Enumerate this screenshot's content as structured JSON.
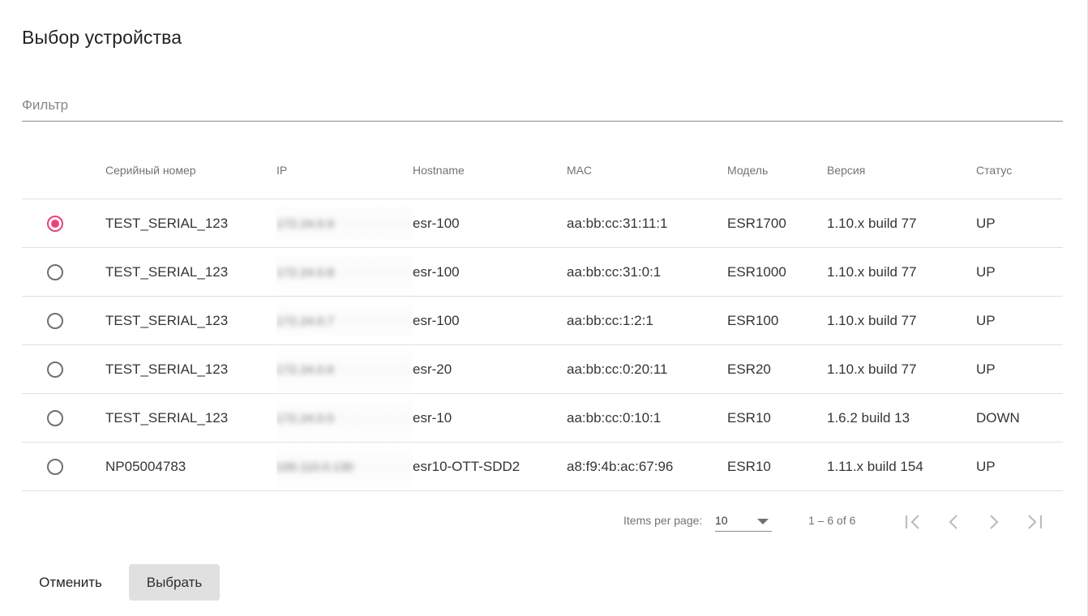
{
  "dialog": {
    "title": "Выбор устройства"
  },
  "filter": {
    "placeholder": "Фильтр",
    "value": ""
  },
  "table": {
    "columns": [
      "Серийный номер",
      "IP",
      "Hostname",
      "MAC",
      "Модель",
      "Версия",
      "Статус"
    ],
    "rows": [
      {
        "selected": true,
        "serial": "TEST_SERIAL_123",
        "ip": "172.24.0.9",
        "hostname": "esr-100",
        "mac": "aa:bb:cc:31:11:1",
        "model": "ESR1700",
        "version": "1.10.x build 77",
        "status": "UP"
      },
      {
        "selected": false,
        "serial": "TEST_SERIAL_123",
        "ip": "172.24.0.8",
        "hostname": "esr-100",
        "mac": "aa:bb:cc:31:0:1",
        "model": "ESR1000",
        "version": "1.10.x build 77",
        "status": "UP"
      },
      {
        "selected": false,
        "serial": "TEST_SERIAL_123",
        "ip": "172.24.0.7",
        "hostname": "esr-100",
        "mac": "aa:bb:cc:1:2:1",
        "model": "ESR100",
        "version": "1.10.x build 77",
        "status": "UP"
      },
      {
        "selected": false,
        "serial": "TEST_SERIAL_123",
        "ip": "172.24.0.6",
        "hostname": "esr-20",
        "mac": "aa:bb:cc:0:20:11",
        "model": "ESR20",
        "version": "1.10.x build 77",
        "status": "UP"
      },
      {
        "selected": false,
        "serial": "TEST_SERIAL_123",
        "ip": "172.24.0.5",
        "hostname": "esr-10",
        "mac": "aa:bb:cc:0:10:1",
        "model": "ESR10",
        "version": "1.6.2 build 13",
        "status": "DOWN"
      },
      {
        "selected": false,
        "serial": "NP05004783",
        "ip": "100.110.0.130",
        "hostname": "esr10-OTT-SDD2",
        "mac": "a8:f9:4b:ac:67:96",
        "model": "ESR10",
        "version": "1.11.x build 154",
        "status": "UP"
      }
    ]
  },
  "paginator": {
    "items_per_page_label": "Items per page:",
    "page_size": "10",
    "range_label": "1 – 6 of 6",
    "first_icon": "first-page-icon",
    "prev_icon": "chevron-left-icon",
    "next_icon": "chevron-right-icon",
    "last_icon": "last-page-icon"
  },
  "actions": {
    "cancel_label": "Отменить",
    "select_label": "Выбрать"
  },
  "colors": {
    "accent": "#ec407a",
    "button_bg": "#e0e0e0",
    "divider": "#e0e0e0"
  }
}
